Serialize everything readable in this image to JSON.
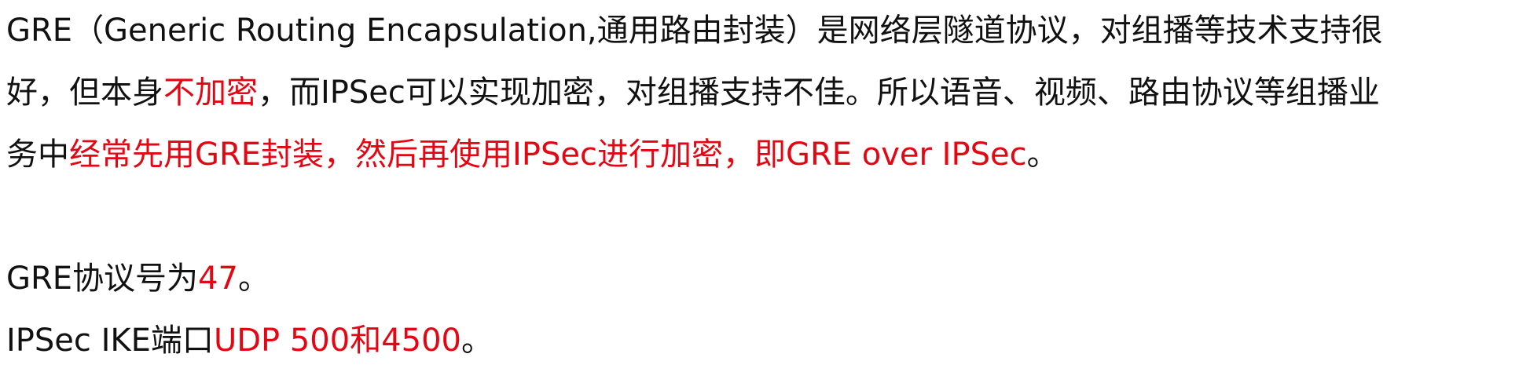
{
  "colors": {
    "text": "#111111",
    "highlight": "#e30613",
    "background": "#ffffff"
  },
  "para1": {
    "line1": {
      "a": "GRE（Generic Routing Encapsulation,通用路由封装）是网络层隧道协议，对组播等技术支持很"
    },
    "line2": {
      "a": "好，但本身",
      "b": "不加密",
      "c": "，而IPSec可以实现加密，对组播支持不佳。所以语音、视频、路由协议等组播业"
    },
    "line3": {
      "a": "务中",
      "b": "经常先用GRE封装，然后再使用IPSec进行加密，即GRE over IPSec",
      "c": "。"
    }
  },
  "para2": {
    "a": "GRE协议号为",
    "b": "47",
    "c": "。"
  },
  "para3": {
    "a": "IPSec IKE端口",
    "b": "UDP 500和4500",
    "c": "。"
  }
}
